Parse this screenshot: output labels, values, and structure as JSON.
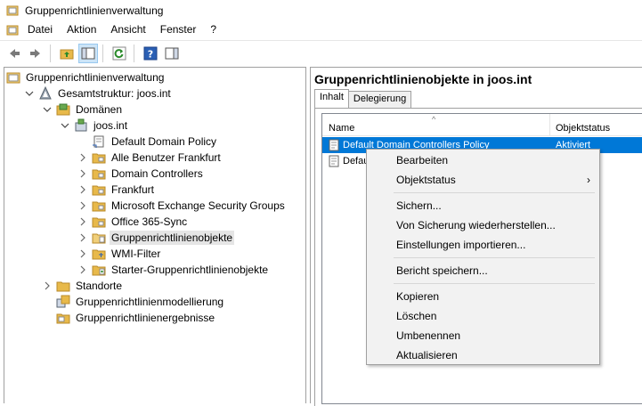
{
  "window": {
    "title": "Gruppenrichtlinienverwaltung",
    "app_icon": "gpmc-icon"
  },
  "menu": [
    "Datei",
    "Aktion",
    "Ansicht",
    "Fenster",
    "?"
  ],
  "toolbar": [
    {
      "name": "back-button",
      "icon": "arrow-left-icon"
    },
    {
      "name": "forward-button",
      "icon": "arrow-right-icon"
    },
    {
      "name": "up-folder-button",
      "icon": "folder-up-icon"
    },
    {
      "name": "show-hide-console-tree-button",
      "icon": "console-tree-icon"
    },
    {
      "name": "refresh-button",
      "icon": "refresh-icon"
    },
    {
      "name": "help-button",
      "icon": "help-icon"
    },
    {
      "name": "show-hide-action-pane-button",
      "icon": "action-pane-icon"
    }
  ],
  "tree": [
    {
      "label": "Gruppenrichtlinienverwaltung",
      "level": 0,
      "expander": "none",
      "icon": "gpmc-icon"
    },
    {
      "label": "Gesamtstruktur: joos.int",
      "level": 1,
      "expander": "expanded",
      "icon": "forest-icon"
    },
    {
      "label": "Domänen",
      "level": 2,
      "expander": "expanded",
      "icon": "domains-icon"
    },
    {
      "label": "joos.int",
      "level": 3,
      "expander": "expanded",
      "icon": "domain-icon"
    },
    {
      "label": "Default Domain Policy",
      "level": 4,
      "expander": "none",
      "icon": "gpo-link-icon"
    },
    {
      "label": "Alle Benutzer Frankfurt",
      "level": 4,
      "expander": "collapsed",
      "icon": "ou-folder-icon"
    },
    {
      "label": "Domain Controllers",
      "level": 4,
      "expander": "collapsed",
      "icon": "ou-folder-icon"
    },
    {
      "label": "Frankfurt",
      "level": 4,
      "expander": "collapsed",
      "icon": "ou-folder-icon"
    },
    {
      "label": "Microsoft Exchange Security Groups",
      "level": 4,
      "expander": "collapsed",
      "icon": "ou-folder-icon"
    },
    {
      "label": "Office 365-Sync",
      "level": 4,
      "expander": "collapsed",
      "icon": "ou-folder-icon"
    },
    {
      "label": "Gruppenrichtlinienobjekte",
      "level": 4,
      "expander": "collapsed",
      "icon": "gpo-folder-icon",
      "selected": true
    },
    {
      "label": "WMI-Filter",
      "level": 4,
      "expander": "collapsed",
      "icon": "wmi-folder-icon"
    },
    {
      "label": "Starter-Gruppenrichtlinienobjekte",
      "level": 4,
      "expander": "collapsed",
      "icon": "starter-gpo-folder-icon"
    },
    {
      "label": "Standorte",
      "level": 2,
      "expander": "collapsed",
      "icon": "sites-icon"
    },
    {
      "label": "Gruppenrichtlinienmodellierung",
      "level": 2,
      "expander": "none",
      "icon": "modeling-icon"
    },
    {
      "label": "Gruppenrichtlinienergebnisse",
      "level": 2,
      "expander": "none",
      "icon": "results-icon"
    }
  ],
  "right": {
    "title": "Gruppenrichtlinienobjekte in joos.int",
    "tabs": [
      "Inhalt",
      "Delegierung"
    ],
    "columns": [
      "Name",
      "Objektstatus"
    ],
    "rows": [
      {
        "name": "Default Domain Controllers Policy",
        "status": "Aktiviert",
        "selected": true
      },
      {
        "name": "Defau",
        "status": "",
        "selected": false
      }
    ]
  },
  "context_menu": [
    {
      "type": "item",
      "label": "Bearbeiten"
    },
    {
      "type": "item",
      "label": "Objektstatus",
      "submenu": true,
      "submenu_glyph": "›"
    },
    {
      "type": "separator"
    },
    {
      "type": "item",
      "label": "Sichern..."
    },
    {
      "type": "item",
      "label": "Von Sicherung wiederherstellen..."
    },
    {
      "type": "item",
      "label": "Einstellungen importieren..."
    },
    {
      "type": "separator"
    },
    {
      "type": "item",
      "label": "Bericht speichern..."
    },
    {
      "type": "separator"
    },
    {
      "type": "item",
      "label": "Kopieren"
    },
    {
      "type": "item",
      "label": "Löschen"
    },
    {
      "type": "item",
      "label": "Umbenennen"
    },
    {
      "type": "item",
      "label": "Aktualisieren"
    }
  ],
  "colors": {
    "selection": "#0078d7",
    "tree_selection": "#e5e5e5",
    "folder": "#e8b94a"
  }
}
